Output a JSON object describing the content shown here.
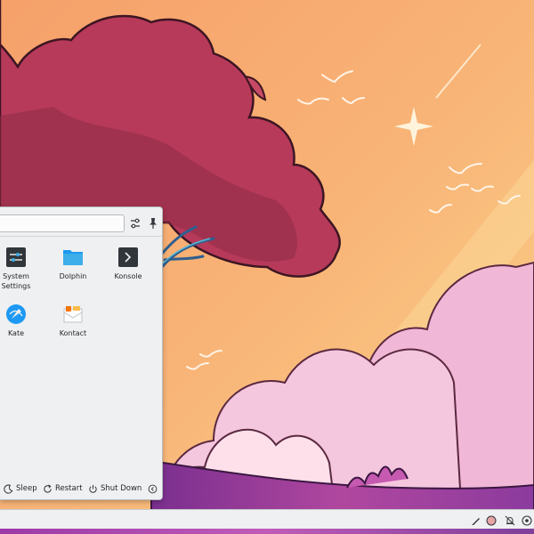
{
  "search": {
    "value": "",
    "placeholder": ""
  },
  "apps": [
    {
      "label_line1": "System",
      "label_line2": "Settings",
      "icon": "system-settings-icon"
    },
    {
      "label_line1": "Dolphin",
      "label_line2": "",
      "icon": "folder-icon"
    },
    {
      "label_line1": "Konsole",
      "label_line2": "",
      "icon": "terminal-icon"
    },
    {
      "label_line1": "Kate",
      "label_line2": "",
      "icon": "kate-icon"
    },
    {
      "label_line1": "Kontact",
      "label_line2": "",
      "icon": "kontact-icon"
    }
  ],
  "footer": {
    "sleep_label": "Sleep",
    "restart_label": "Restart",
    "shutdown_label": "Shut Down"
  },
  "colors": {
    "accent": "#3daee9",
    "menu_bg": "#eff0f1",
    "text": "#232629"
  }
}
